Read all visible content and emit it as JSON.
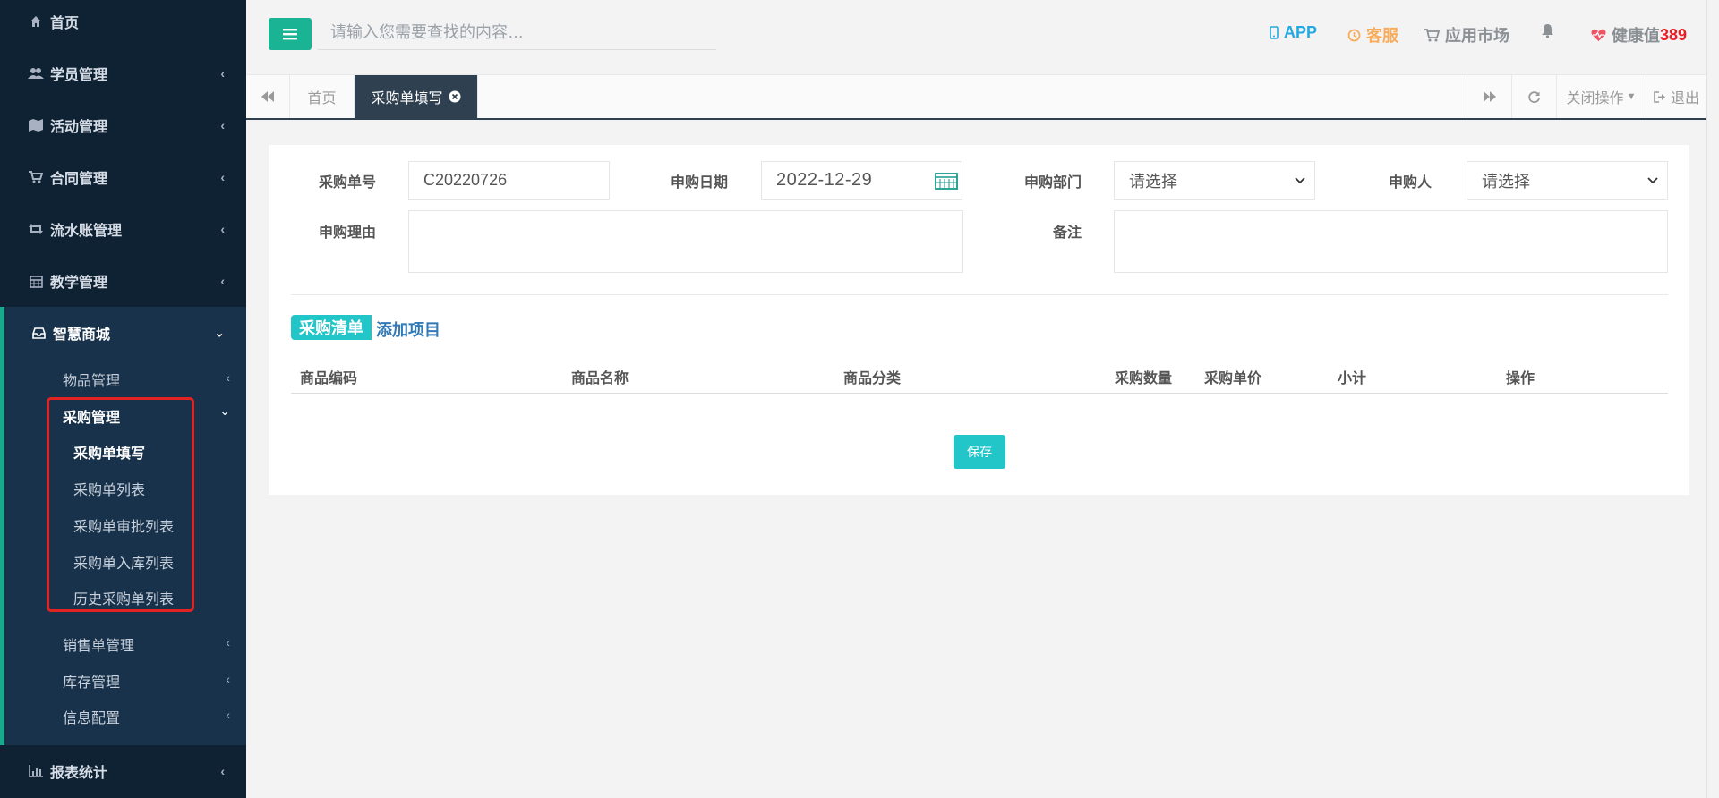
{
  "sidebar": {
    "home": "首页",
    "students": "学员管理",
    "activities": "活动管理",
    "contracts": "合同管理",
    "ledger": "流水账管理",
    "teaching": "教学管理",
    "mall": "智慧商城",
    "goods": "物品管理",
    "purchase": "采购管理",
    "purchase_fill": "采购单填写",
    "purchase_list": "采购单列表",
    "purchase_approve": "采购单审批列表",
    "purchase_stock": "采购单入库列表",
    "purchase_history": "历史采购单列表",
    "sales": "销售单管理",
    "stock": "库存管理",
    "info": "信息配置",
    "reports": "报表统计"
  },
  "header": {
    "search_placeholder": "请输入您需要查找的内容…",
    "app": "APP",
    "service": "客服",
    "market": "应用市场",
    "health_label": "健康值",
    "health_value": "389"
  },
  "tabs": {
    "home": "首页",
    "current": "采购单填写",
    "close_ops": "关闭操作",
    "logout": "退出"
  },
  "form": {
    "order_no_label": "采购单号",
    "order_no_value": "C20220726",
    "date_label": "申购日期",
    "date_value": "2022-12-29",
    "dept_label": "申购部门",
    "dept_value": "请选择",
    "person_label": "申购人",
    "person_value": "请选择",
    "reason_label": "申购理由",
    "note_label": "备注"
  },
  "list": {
    "badge": "采购清单",
    "add": "添加项目",
    "columns": [
      "商品编码",
      "商品名称",
      "商品分类",
      "采购数量",
      "采购单价",
      "小计",
      "操作"
    ],
    "save": "保存"
  },
  "colors": {
    "sidebar_bg": "#0f2234",
    "primary_green": "#1ab394",
    "info_teal": "#23c6c8",
    "highlight_red": "#e32222"
  }
}
